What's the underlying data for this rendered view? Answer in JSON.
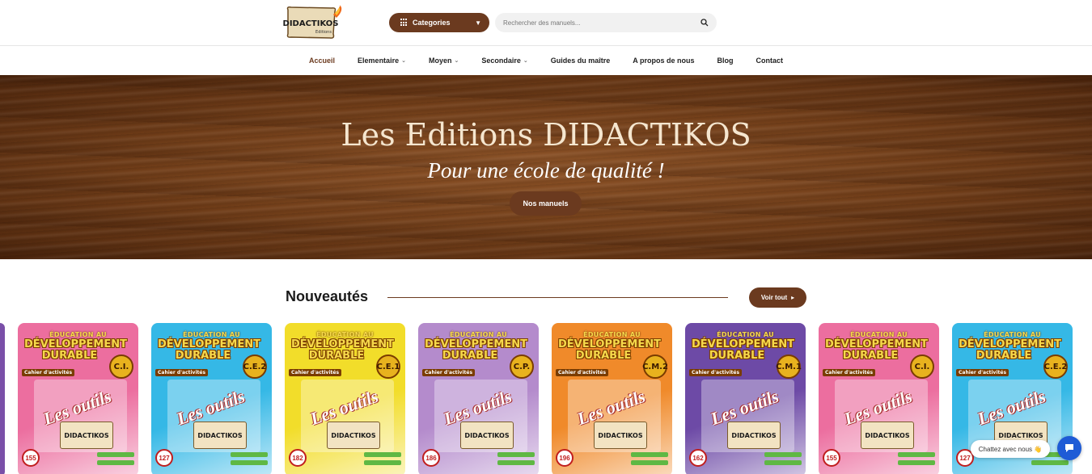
{
  "header": {
    "logo_text": "DIDACTIKOS",
    "logo_sub": "Editions",
    "categories_label": "Categories",
    "search_placeholder": "Rechercher des manuels..."
  },
  "nav": {
    "items": [
      {
        "label": "Accueil",
        "active": true,
        "dropdown": false
      },
      {
        "label": "Elementaire",
        "active": false,
        "dropdown": true
      },
      {
        "label": "Moyen",
        "active": false,
        "dropdown": true
      },
      {
        "label": "Secondaire",
        "active": false,
        "dropdown": true
      },
      {
        "label": "Guides du maître",
        "active": false,
        "dropdown": false
      },
      {
        "label": "A propos de nous",
        "active": false,
        "dropdown": false
      },
      {
        "label": "Blog",
        "active": false,
        "dropdown": false
      },
      {
        "label": "Contact",
        "active": false,
        "dropdown": false
      }
    ]
  },
  "hero": {
    "title": "Les Editions DIDACTIKOS",
    "subtitle": "Pour une école de qualité !",
    "button_label": "Nos manuels"
  },
  "section": {
    "title": "Nouveautés",
    "see_all_label": "Voir tout"
  },
  "books": [
    {
      "level": "C.I.",
      "price": "155",
      "color": "#ec6e9f"
    },
    {
      "level": "C.E.2",
      "price": "127",
      "color": "#35b8e6"
    },
    {
      "level": "C.E.1",
      "price": "182",
      "color": "#f2dd2a"
    },
    {
      "level": "C.P.",
      "price": "186",
      "color": "#b48bcc"
    },
    {
      "level": "C.M.2",
      "price": "196",
      "color": "#f08a2a"
    },
    {
      "level": "C.M.1",
      "price": "162",
      "color": "#6d4aa6"
    },
    {
      "level": "C.I.",
      "price": "155",
      "color": "#ec6e9f"
    },
    {
      "level": "C.E.2",
      "price": "127",
      "color": "#35b8e6"
    }
  ],
  "book_common": {
    "top_line": "ÉDUCATION AU",
    "main_line_1": "DÉVELOPPEMENT",
    "main_line_2": "DURABLE",
    "cahier": "Cahier d'activités",
    "outils": "Les outils",
    "publisher": "DIDACTIKOS"
  },
  "chat": {
    "bubble_text": "Chattez avec nous 👋"
  },
  "colors": {
    "brand_brown": "#6b3a1f",
    "chat_blue": "#1e5bd6"
  }
}
